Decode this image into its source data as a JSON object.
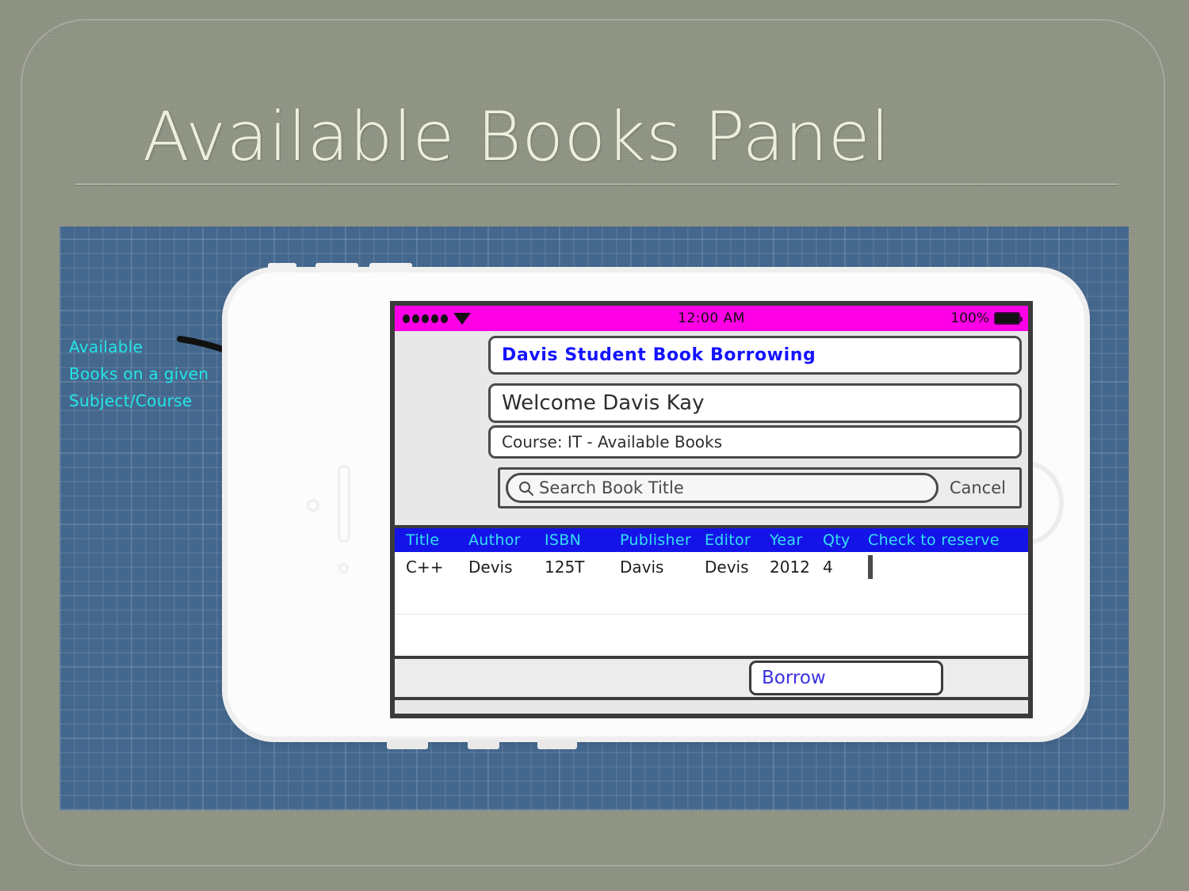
{
  "slide": {
    "title": "Available Books Panel"
  },
  "annotation": {
    "lines": [
      "Available",
      "Books on a given",
      "Subject/Course"
    ],
    "color": "#22e7e7",
    "arrow_name": "curved-arrow"
  },
  "blueprint": {
    "background_color": "#44678d"
  },
  "phone": {
    "status_bar": {
      "background_color": "#ff00e6",
      "signal_dots": 5,
      "wifi_icon": "wifi-icon",
      "time": "12:00 AM",
      "battery_percent": "100%",
      "battery_icon": "battery-full-icon"
    },
    "app_title": "Davis Student Book Borrowing",
    "app_title_color": "#1414ff",
    "welcome": "Welcome Davis Kay",
    "course": "Course: IT - Available Books",
    "search": {
      "icon": "search-icon",
      "placeholder": "Search Book Title",
      "value": "",
      "cancel_label": "Cancel"
    },
    "table": {
      "header_background": "#1414e8",
      "header_text_color": "#33e0f0",
      "columns": [
        "Title",
        "Author",
        "ISBN",
        "Publisher",
        "Editor",
        "Year",
        "Qty",
        "Check to reserve"
      ],
      "rows": [
        {
          "title": "C++",
          "author": "Devis",
          "isbn": "125T",
          "publisher": "Davis",
          "editor": "Devis",
          "year": "2012",
          "qty": "4",
          "reserve_checked": false
        }
      ]
    },
    "toolbar": {
      "borrow_label": "Borrow",
      "borrow_color": "#3a32e0"
    }
  }
}
